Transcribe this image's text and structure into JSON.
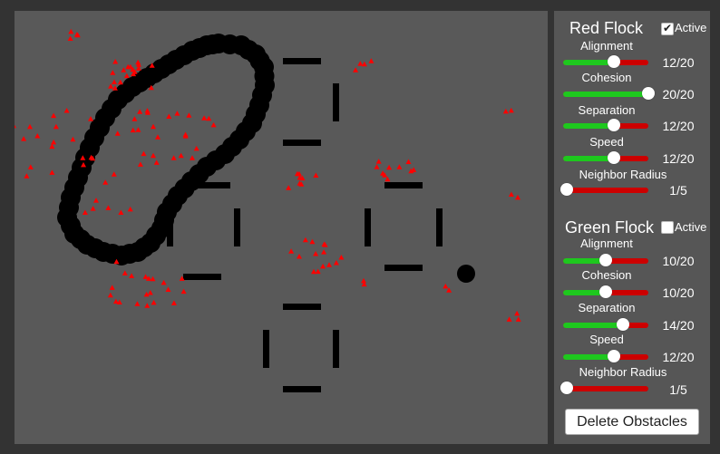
{
  "colors": {
    "background": "#595959",
    "panel": "#565656",
    "boid_red": "#ff0000",
    "obstacle": "#000000",
    "slider_fill": "#1ec81e",
    "slider_track": "#cc0000"
  },
  "red_flock": {
    "title": "Red Flock",
    "active_label": "Active",
    "active": true,
    "params": [
      {
        "label": "Alignment",
        "value": 12,
        "max": 20,
        "value_text": "12/20"
      },
      {
        "label": "Cohesion",
        "value": 20,
        "max": 20,
        "value_text": "20/20"
      },
      {
        "label": "Separation",
        "value": 12,
        "max": 20,
        "value_text": "12/20"
      },
      {
        "label": "Speed",
        "value": 12,
        "max": 20,
        "value_text": "12/20"
      },
      {
        "label": "Neighbor Radius",
        "value": 1,
        "max": 5,
        "value_text": "1/5",
        "slider_fraction": 0.04
      }
    ]
  },
  "green_flock": {
    "title": "Green Flock",
    "active_label": "Active",
    "active": false,
    "params": [
      {
        "label": "Alignment",
        "value": 10,
        "max": 20,
        "value_text": "10/20"
      },
      {
        "label": "Cohesion",
        "value": 10,
        "max": 20,
        "value_text": "10/20"
      },
      {
        "label": "Separation",
        "value": 14,
        "max": 20,
        "value_text": "14/20"
      },
      {
        "label": "Speed",
        "value": 12,
        "max": 20,
        "value_text": "12/20"
      },
      {
        "label": "Neighbor Radius",
        "value": 1,
        "max": 5,
        "value_text": "1/5",
        "slider_fraction": 0.04
      }
    ]
  },
  "delete_button_label": "Delete Obstacles"
}
